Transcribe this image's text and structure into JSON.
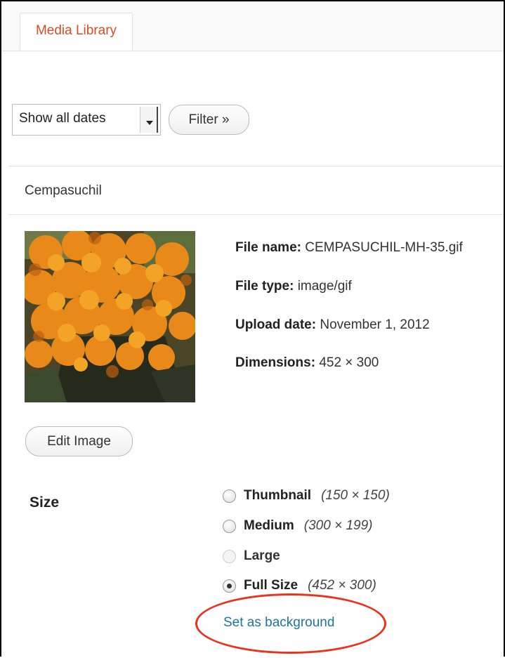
{
  "tabs": {
    "media_library": "Media Library"
  },
  "filters": {
    "date_selected": "Show all dates",
    "filter_button": "Filter »"
  },
  "item": {
    "title": "Cempasuchil",
    "thumbnail_icon": "marigold-photo",
    "file_name_label": "File name:",
    "file_name": "CEMPASUCHIL-MH-35.gif",
    "file_type_label": "File type:",
    "file_type": "image/gif",
    "upload_date_label": "Upload date:",
    "upload_date": "November 1, 2012",
    "dimensions_label": "Dimensions:",
    "dimensions": "452 × 300",
    "edit_button": "Edit Image"
  },
  "size": {
    "label": "Size",
    "options": [
      {
        "name": "Thumbnail",
        "dims": "(150 × 150)",
        "checked": false,
        "disabled": false
      },
      {
        "name": "Medium",
        "dims": "(300 × 199)",
        "checked": false,
        "disabled": false
      },
      {
        "name": "Large",
        "dims": "",
        "checked": false,
        "disabled": true
      },
      {
        "name": "Full Size",
        "dims": "(452 × 300)",
        "checked": true,
        "disabled": false
      }
    ]
  },
  "actions": {
    "set_background": "Set as background"
  },
  "colors": {
    "tab_text": "#d54e21",
    "link": "#21759b",
    "annotation_circle": "#e8341c"
  }
}
